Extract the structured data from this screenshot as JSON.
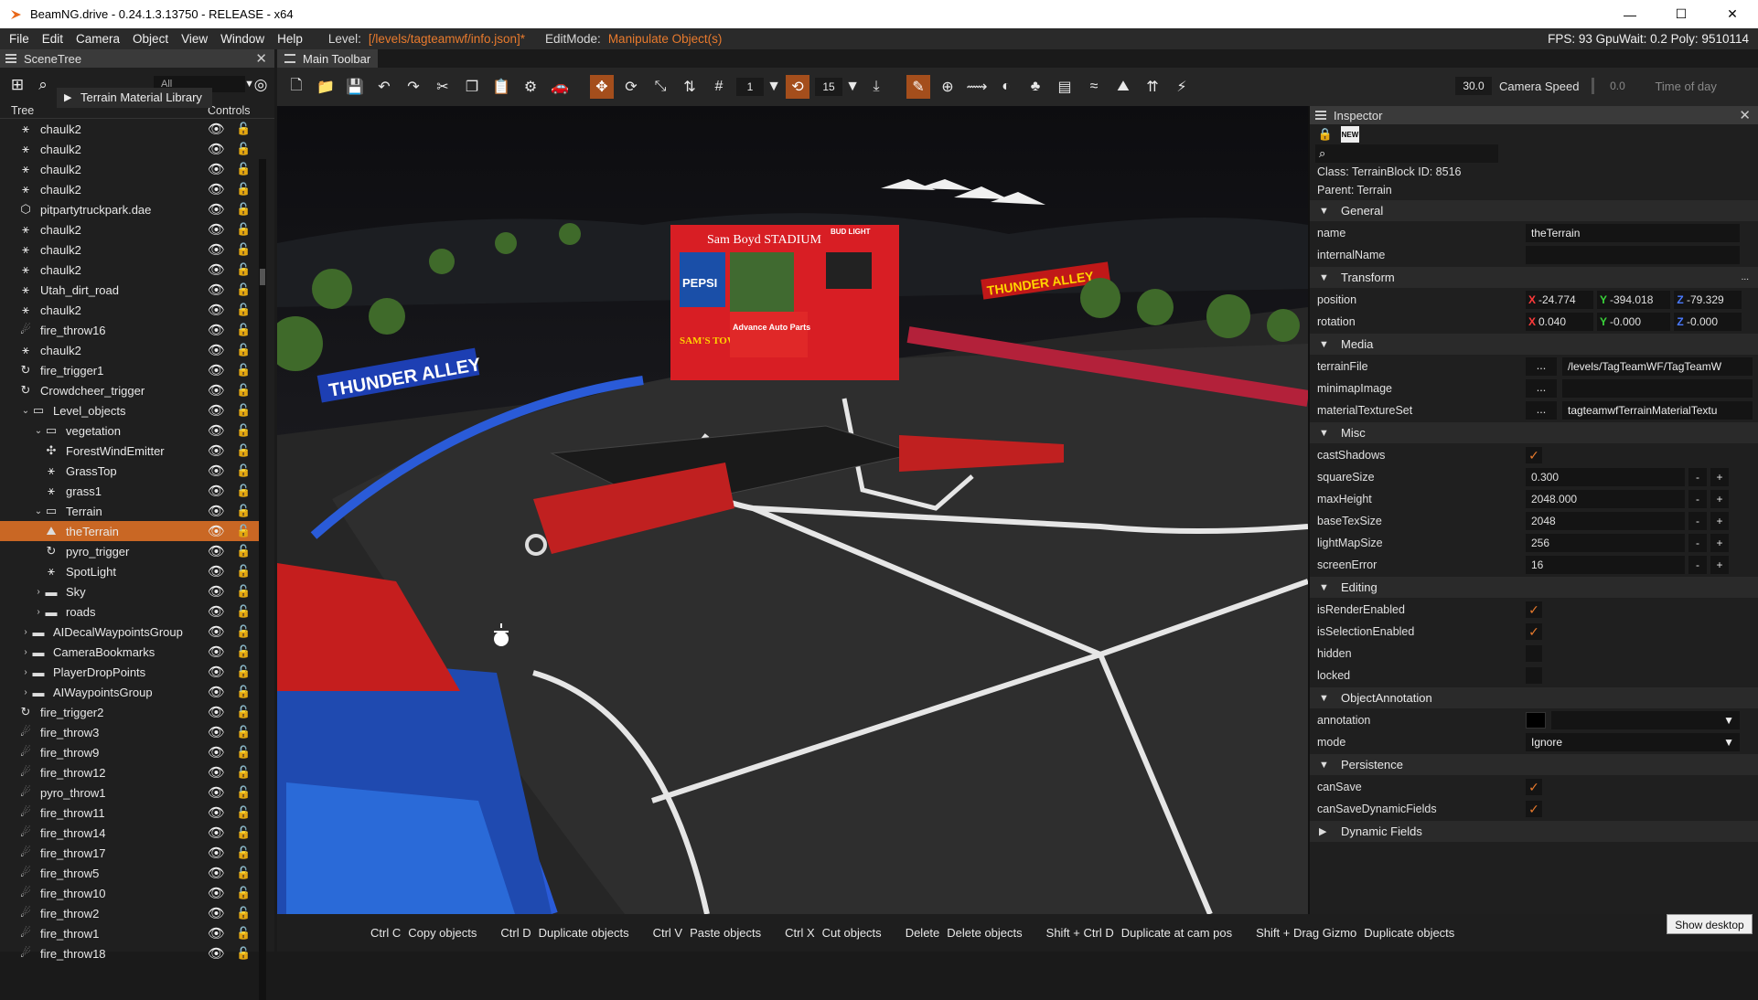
{
  "window": {
    "title": "BeamNG.drive - 0.24.1.3.13750 - RELEASE - x64",
    "minimize": "—",
    "maximize": "☐",
    "close": "✕"
  },
  "menu": {
    "items": [
      "File",
      "Edit",
      "Camera",
      "Object",
      "View",
      "Window",
      "Help"
    ],
    "level_label": "Level:",
    "level_value": "[/levels/tagteamwf/info.json]*",
    "editmode_label": "EditMode:",
    "editmode_value": "Manipulate Object(s)",
    "stats": "FPS: 93  GpuWait: 0.2  Poly: 9510114"
  },
  "scenetree": {
    "title": "SceneTree",
    "filter": "All",
    "terrain_material_library": "Terrain Material Library",
    "col_tree": "Tree",
    "col_controls": "Controls",
    "rows": [
      {
        "label": "chaulk2",
        "icon": "⚹",
        "indent": 0
      },
      {
        "label": "chaulk2",
        "icon": "⚹",
        "indent": 0
      },
      {
        "label": "chaulk2",
        "icon": "⚹",
        "indent": 0
      },
      {
        "label": "chaulk2",
        "icon": "⚹",
        "indent": 0
      },
      {
        "label": "pitpartytruckpark.dae",
        "icon": "⬡",
        "indent": 0
      },
      {
        "label": "chaulk2",
        "icon": "⚹",
        "indent": 0
      },
      {
        "label": "chaulk2",
        "icon": "⚹",
        "indent": 0
      },
      {
        "label": "chaulk2",
        "icon": "⚹",
        "indent": 0
      },
      {
        "label": "Utah_dirt_road",
        "icon": "⚹",
        "indent": 0
      },
      {
        "label": "chaulk2",
        "icon": "⚹",
        "indent": 0
      },
      {
        "label": "fire_throw16",
        "icon": "☄",
        "indent": 0
      },
      {
        "label": "chaulk2",
        "icon": "⚹",
        "indent": 0
      },
      {
        "label": "fire_trigger1",
        "icon": "↻",
        "indent": 0
      },
      {
        "label": "Crowdcheer_trigger",
        "icon": "↻",
        "indent": 0
      },
      {
        "label": "Level_objects",
        "icon": "▭",
        "indent": 1,
        "arrow": "⌄"
      },
      {
        "label": "vegetation",
        "icon": "▭",
        "indent": 2,
        "arrow": "⌄"
      },
      {
        "label": "ForestWindEmitter",
        "icon": "✣",
        "indent": 2
      },
      {
        "label": "GrassTop",
        "icon": "⚹",
        "indent": 2
      },
      {
        "label": "grass1",
        "icon": "⚹",
        "indent": 2
      },
      {
        "label": "Terrain",
        "icon": "▭",
        "indent": 2,
        "arrow": "⌄"
      },
      {
        "label": "theTerrain",
        "icon": "⛰",
        "indent": 2,
        "selected": true
      },
      {
        "label": "pyro_trigger",
        "icon": "↻",
        "indent": 2
      },
      {
        "label": "SpotLight",
        "icon": "⚹",
        "indent": 2
      },
      {
        "label": "Sky",
        "icon": "▬",
        "indent": 2,
        "arrow": "›"
      },
      {
        "label": "roads",
        "icon": "▬",
        "indent": 2,
        "arrow": "›"
      },
      {
        "label": "AIDecalWaypointsGroup",
        "icon": "▬",
        "indent": 1,
        "arrow": "›"
      },
      {
        "label": "CameraBookmarks",
        "icon": "▬",
        "indent": 1,
        "arrow": "›"
      },
      {
        "label": "PlayerDropPoints",
        "icon": "▬",
        "indent": 1,
        "arrow": "›"
      },
      {
        "label": "AIWaypointsGroup",
        "icon": "▬",
        "indent": 1,
        "arrow": "›"
      },
      {
        "label": "fire_trigger2",
        "icon": "↻",
        "indent": 0
      },
      {
        "label": "fire_throw3",
        "icon": "☄",
        "indent": 0
      },
      {
        "label": "fire_throw9",
        "icon": "☄",
        "indent": 0
      },
      {
        "label": "fire_throw12",
        "icon": "☄",
        "indent": 0
      },
      {
        "label": "pyro_throw1",
        "icon": "☄",
        "indent": 0
      },
      {
        "label": "fire_throw11",
        "icon": "☄",
        "indent": 0
      },
      {
        "label": "fire_throw14",
        "icon": "☄",
        "indent": 0
      },
      {
        "label": "fire_throw17",
        "icon": "☄",
        "indent": 0
      },
      {
        "label": "fire_throw5",
        "icon": "☄",
        "indent": 0
      },
      {
        "label": "fire_throw10",
        "icon": "☄",
        "indent": 0
      },
      {
        "label": "fire_throw2",
        "icon": "☄",
        "indent": 0
      },
      {
        "label": "fire_throw1",
        "icon": "☄",
        "indent": 0
      },
      {
        "label": "fire_throw18",
        "icon": "☄",
        "indent": 0
      }
    ]
  },
  "toolbar": {
    "title": "Main Toolbar",
    "snap_value": "1",
    "angle_value": "15",
    "camera_speed_value": "30.0",
    "camera_speed_label": "Camera Speed",
    "time_value": "0.0",
    "time_label": "Time of day"
  },
  "viewport": {
    "banner_left": "THUNDER ALLEY",
    "banner_right": "THUNDER ALLEY",
    "stadium": "Sam Boyd STADIUM",
    "pepsi": "PEPSI",
    "samstown": "SAM'S TOWN",
    "budlight": "BUD LIGHT",
    "advance": "Advance Auto Parts"
  },
  "shortcuts": [
    {
      "key": "Ctrl C",
      "action": "Copy objects"
    },
    {
      "key": "Ctrl D",
      "action": "Duplicate objects"
    },
    {
      "key": "Ctrl V",
      "action": "Paste objects"
    },
    {
      "key": "Ctrl X",
      "action": "Cut objects"
    },
    {
      "key": "Delete",
      "action": "Delete objects"
    },
    {
      "key": "Shift + Ctrl D",
      "action": "Duplicate at cam pos"
    },
    {
      "key": "Shift + Drag Gizmo",
      "action": "Duplicate objects"
    }
  ],
  "show_desktop": "Show desktop",
  "inspector": {
    "title": "Inspector",
    "new_badge": "NEW",
    "class_line": "Class: TerrainBlock     ID: 8516",
    "parent_line": "Parent: Terrain",
    "sections": {
      "general": "General",
      "transform": "Transform",
      "media": "Media",
      "misc": "Misc",
      "editing": "Editing",
      "objectannotation": "ObjectAnnotation",
      "persistence": "Persistence",
      "dynamic": "Dynamic Fields"
    },
    "name_label": "name",
    "name_value": "theTerrain",
    "internalname_label": "internalName",
    "internalname_value": "",
    "transform_more": "...",
    "position_label": "position",
    "pos_x": "-24.774",
    "pos_y": "-394.018",
    "pos_z": "-79.329",
    "rotation_label": "rotation",
    "rot_x": "0.040",
    "rot_y": "-0.000",
    "rot_z": "-0.000",
    "terrainfile_label": "terrainFile",
    "terrainfile_value": "/levels/TagTeamWF/TagTeamW",
    "minimap_label": "minimapImage",
    "minimap_value": "",
    "mts_label": "materialTextureSet",
    "mts_value": "tagteamwfTerrainMaterialTextu",
    "castshadows_label": "castShadows",
    "squaresize_label": "squareSize",
    "squaresize_value": "0.300",
    "maxheight_label": "maxHeight",
    "maxheight_value": "2048.000",
    "basetex_label": "baseTexSize",
    "basetex_value": "2048",
    "lightmap_label": "lightMapSize",
    "lightmap_value": "256",
    "screenerror_label": "screenError",
    "screenerror_value": "16",
    "isrender_label": "isRenderEnabled",
    "issel_label": "isSelectionEnabled",
    "hidden_label": "hidden",
    "locked_label": "locked",
    "annotation_label": "annotation",
    "mode_label": "mode",
    "mode_value": "Ignore",
    "cansave_label": "canSave",
    "cansavedyn_label": "canSaveDynamicFields",
    "btn_minus": "-",
    "btn_plus": "+",
    "browse": "...",
    "x": "X",
    "y": "Y",
    "z": "Z"
  }
}
